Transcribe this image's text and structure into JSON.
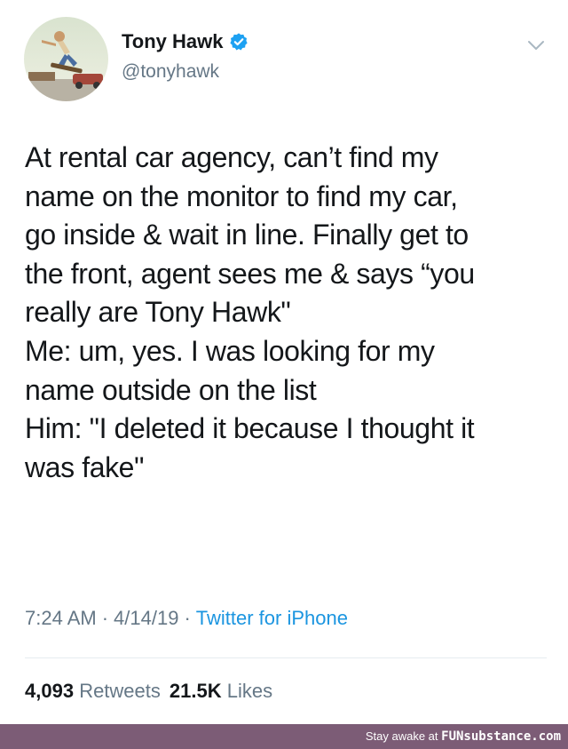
{
  "author": {
    "display_name": "Tony Hawk",
    "handle": "@tonyhawk",
    "verified_icon": "verified-badge-icon",
    "avatar_icon": "avatar-photo"
  },
  "menu_icon": "chevron-down-icon",
  "tweet": {
    "lines": [
      "At rental car agency, can’t find my",
      "name on the monitor to find my car,",
      "go inside & wait in line. Finally get to",
      "the front, agent sees me & says “you",
      "really are Tony Hawk\"",
      "Me: um, yes. I was looking for my",
      "name outside on the list",
      "Him: \"I deleted it because I thought it",
      "was fake\""
    ]
  },
  "meta": {
    "time": "7:24 AM",
    "date": "4/14/19",
    "separator": "·",
    "source": "Twitter for iPhone"
  },
  "stats": {
    "retweets_count": "4,093",
    "retweets_label": "Retweets",
    "likes_count": "21.5K",
    "likes_label": "Likes"
  },
  "footer": {
    "text": "Stay awake at",
    "brand": "FUNsubstance.com"
  },
  "colors": {
    "verified_blue": "#1da1f2",
    "link_blue": "#1b95e0",
    "muted_gray": "#657786",
    "footer_bg": "#7c5c76"
  }
}
